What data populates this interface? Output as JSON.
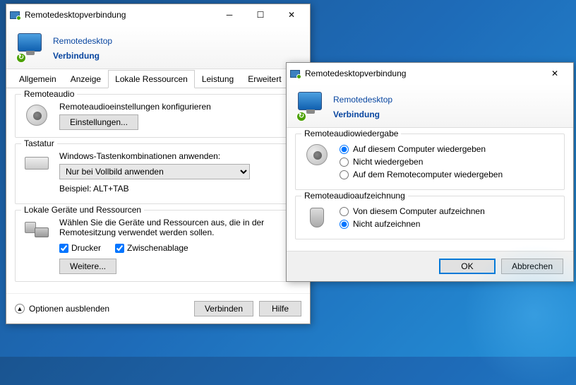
{
  "win1": {
    "title": "Remotedesktopverbindung",
    "banner": {
      "line1": "Remotedesktop",
      "line2": "Verbindung"
    },
    "tabs": [
      "Allgemein",
      "Anzeige",
      "Lokale Ressourcen",
      "Leistung",
      "Erweitert"
    ],
    "active_tab": 2,
    "remoteaudio": {
      "group": "Remoteaudio",
      "text": "Remoteaudioeinstellungen konfigurieren",
      "button": "Einstellungen..."
    },
    "tastatur": {
      "group": "Tastatur",
      "label": "Windows-Tastenkombinationen anwenden:",
      "value": "Nur bei Vollbild anwenden",
      "example": "Beispiel: ALT+TAB"
    },
    "lokale": {
      "group": "Lokale Geräte und Ressourcen",
      "text": "Wählen Sie die Geräte und Ressourcen aus, die in der Remotesitzung verwendet werden sollen.",
      "chk1": "Drucker",
      "chk2": "Zwischenablage",
      "button": "Weitere..."
    },
    "footer": {
      "options": "Optionen ausblenden",
      "connect": "Verbinden",
      "help": "Hilfe"
    }
  },
  "win2": {
    "title": "Remotedesktopverbindung",
    "banner": {
      "line1": "Remotedesktop",
      "line2": "Verbindung"
    },
    "playback": {
      "group": "Remoteaudiowiedergabe",
      "opt1": "Auf diesem Computer wiedergeben",
      "opt2": "Nicht wiedergeben",
      "opt3": "Auf dem Remotecomputer wiedergeben",
      "selected": 0
    },
    "recording": {
      "group": "Remoteaudioaufzeichnung",
      "opt1": "Von diesem Computer aufzeichnen",
      "opt2": "Nicht aufzeichnen",
      "selected": 1
    },
    "ok": "OK",
    "cancel": "Abbrechen"
  }
}
